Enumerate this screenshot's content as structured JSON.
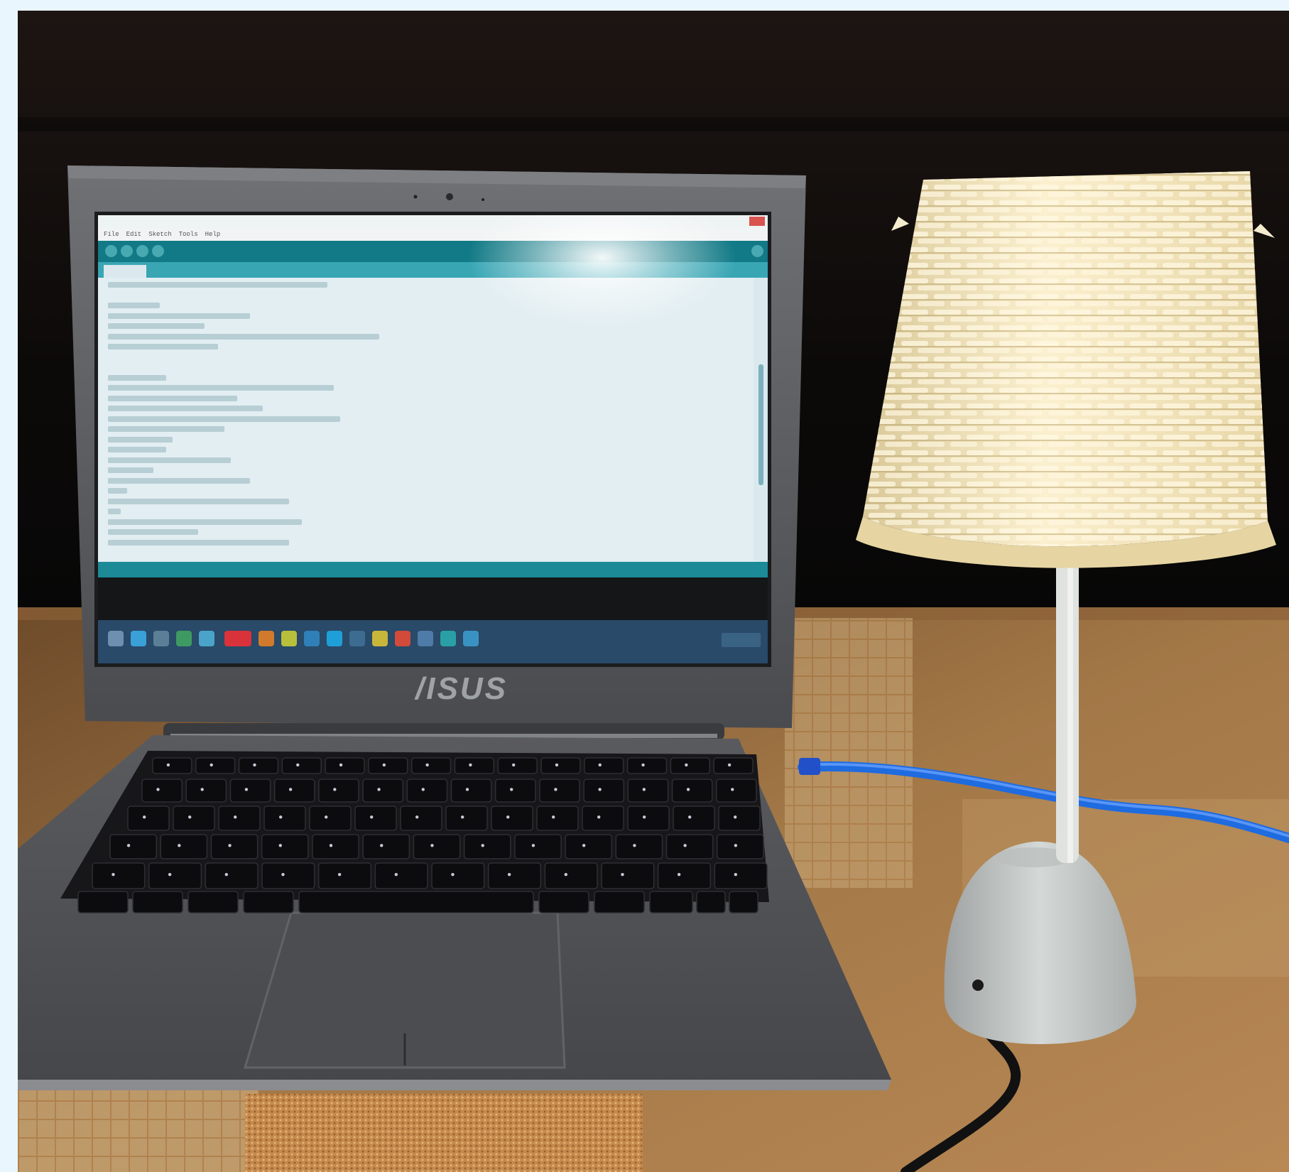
{
  "scene": {
    "laptop_logo": "/ISUS",
    "ide_menu": [
      "File",
      "Edit",
      "Sketch",
      "Tools",
      "Help"
    ]
  },
  "colors": {
    "wall": "#0d0b0a",
    "table": "#a87a4a",
    "laptop_body": "#5b5c60",
    "ide_teal": "#127a86",
    "lampshade": "#efe3bd",
    "usb_cable": "#1f6be0"
  }
}
